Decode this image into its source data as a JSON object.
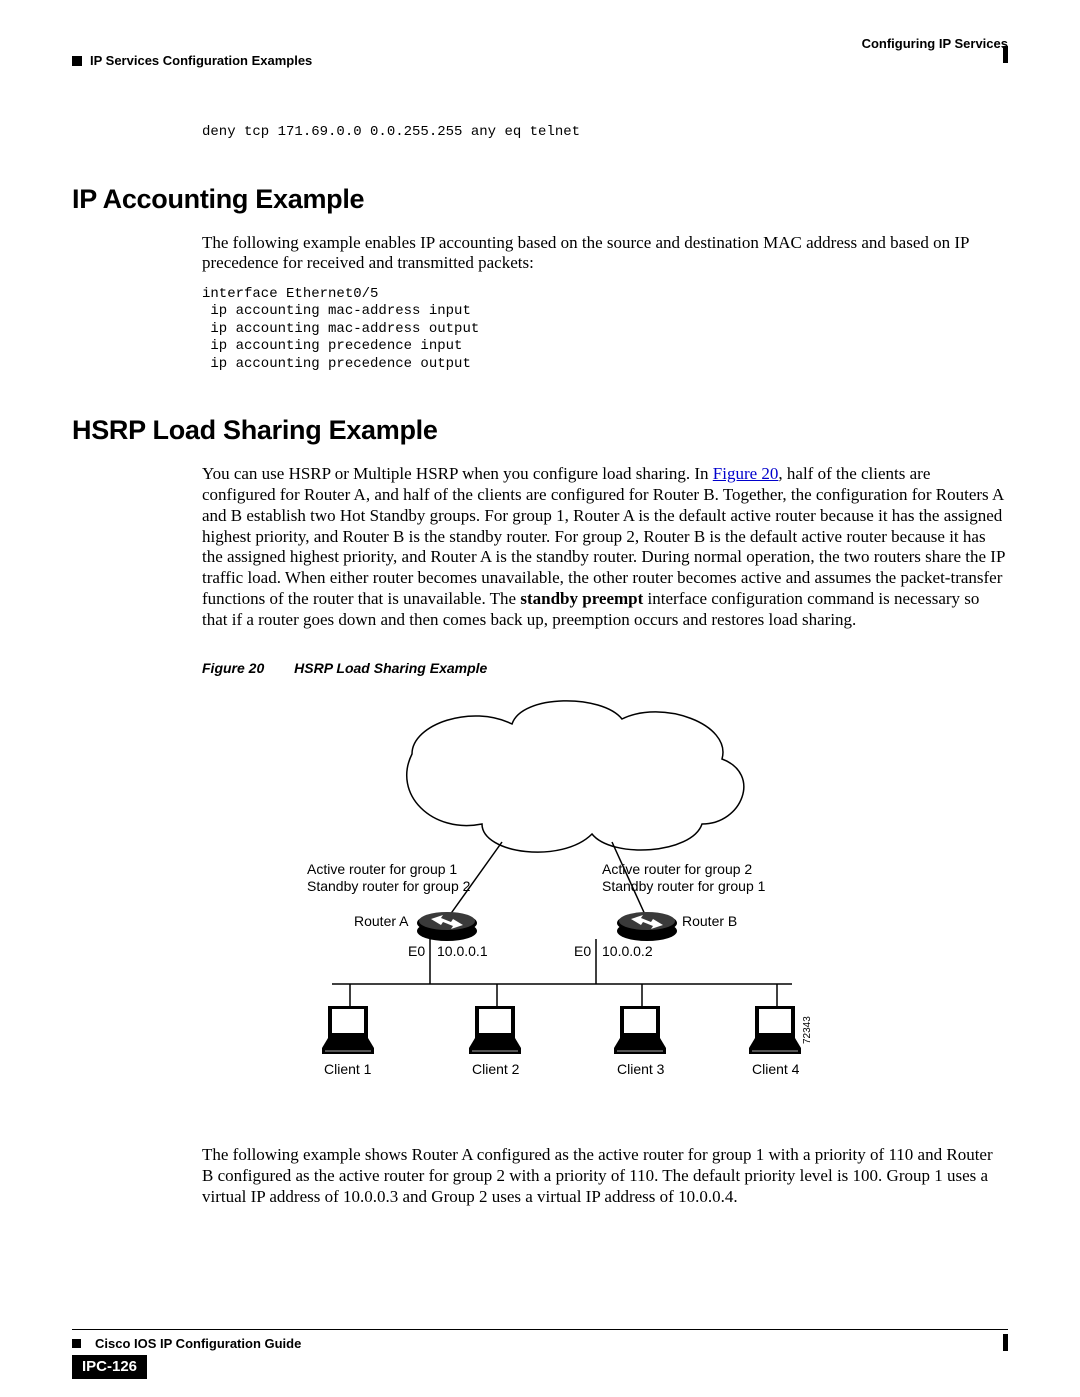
{
  "header": {
    "right": "Configuring IP Services",
    "left": "IP Services Configuration Examples"
  },
  "top_code": "deny tcp 171.69.0.0 0.0.255.255 any eq telnet",
  "section1": {
    "heading": "IP Accounting Example",
    "para": "The following example enables IP accounting based on the source and destination MAC address and based on IP precedence for received and transmitted packets:",
    "code": "interface Ethernet0/5\n ip accounting mac-address input\n ip accounting mac-address output\n ip accounting precedence input\n ip accounting precedence output"
  },
  "section2": {
    "heading": "HSRP Load Sharing Example",
    "para_pre": "You can use HSRP or Multiple HSRP when you configure load sharing. In ",
    "figref": "Figure 20",
    "para_post": ", half of the clients are configured for Router A, and half of the clients are configured for Router B. Together, the configuration for Routers A and B establish two Hot Standby groups. For group 1, Router A is the default active router because it has the assigned highest priority, and Router B is the standby router. For group 2, Router B is the default active router because it has the assigned highest priority, and Router A is the standby router. During normal operation, the two routers share the IP traffic load. When either router becomes unavailable, the other router becomes active and assumes the packet-transfer functions of the router that is unavailable. The ",
    "bold_cmd": "standby preempt",
    "para_tail": " interface configuration command is necessary so that if a router goes down and then comes back up, preemption occurs and restores load sharing.",
    "fig_caption_num": "Figure 20",
    "fig_caption_title": "HSRP Load Sharing Example",
    "bottom_para": "The following example shows Router A configured as the active router for group 1 with a priority of 110 and Router B configured as the active router for group 2 with a priority of 110. The default priority level is 100. Group 1 uses a virtual IP address of 10.0.0.3 and Group 2 uses a virtual IP address of 10.0.0.4."
  },
  "diagram": {
    "routerA": {
      "line1": "Active router for group 1",
      "line2": "Standby router for group 2",
      "name": "Router A",
      "iface": "E0",
      "ip": "10.0.0.1"
    },
    "routerB": {
      "line1": "Active router for group 2",
      "line2": "Standby router for group 1",
      "name": "Router B",
      "iface": "E0",
      "ip": "10.0.0.2"
    },
    "clients": [
      "Client 1",
      "Client 2",
      "Client 3",
      "Client 4"
    ],
    "imgid": "72343"
  },
  "footer": {
    "guide": "Cisco IOS IP Configuration Guide",
    "page": "IPC-126"
  }
}
